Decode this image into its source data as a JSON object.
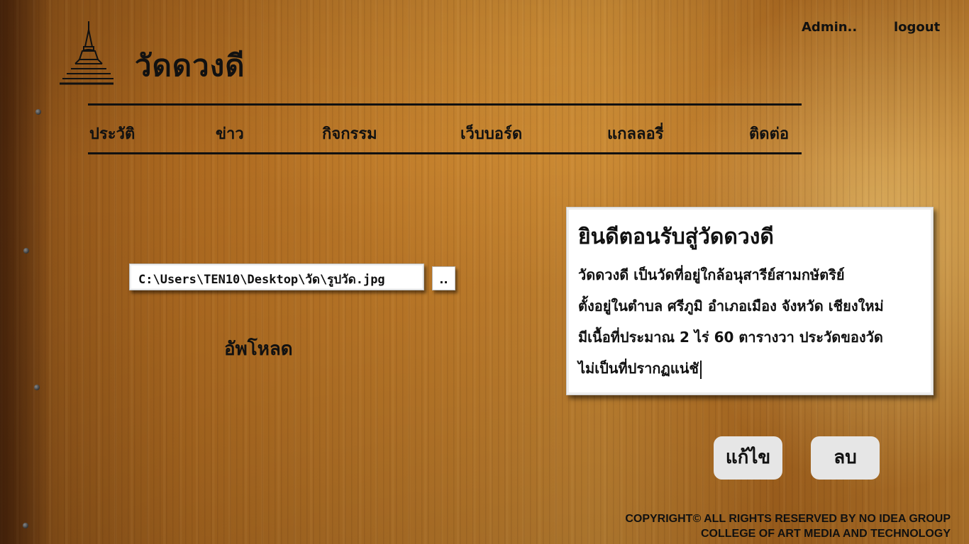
{
  "header": {
    "site_title": "วัดดวงดี",
    "admin_label": "Admin..",
    "logout_label": "logout"
  },
  "nav": {
    "items": [
      {
        "label": "ประวัติ"
      },
      {
        "label": "ข่าว"
      },
      {
        "label": "กิจกรรม"
      },
      {
        "label": "เว็บบอร์ด"
      },
      {
        "label": "แกลลอรี่"
      },
      {
        "label": "ติดต่อ"
      }
    ]
  },
  "upload": {
    "file_path": "C:\\Users\\TEN10\\Desktop\\วัด\\รูปวัด.jpg",
    "browse_label": "..",
    "upload_label": "อัพโหลด"
  },
  "welcome": {
    "title": "ยินดีตอนรับสู่วัดดวงดี",
    "lines": [
      "วัดดวงดี เป็นวัดที่อยู่ใกล้อนุสารีย์สามกษัตริย์",
      "ตั้งอยู่ในตำบล ศรีภูมิ อำเภอเมือง จังหวัด เชียงใหม่",
      "มีเนื้อที่ประมาณ 2 ไร่ 60 ตารางวา ประวัดของวัด",
      "ไม่เป็นที่ปรากฏแน่ชั"
    ]
  },
  "actions": {
    "edit_label": "แก้ไข",
    "delete_label": "ลบ"
  },
  "footer": {
    "line1": "COPYRIGHT©  ALL RIGHTS RESERVED BY NO IDEA GROUP",
    "line2": "COLLEGE OF ART MEDIA AND TECHNOLOGY"
  },
  "icons": {
    "logo": "pagoda-icon"
  },
  "colors": {
    "background": "#b7772a",
    "text": "#111111",
    "button": "#e6e6e6"
  }
}
